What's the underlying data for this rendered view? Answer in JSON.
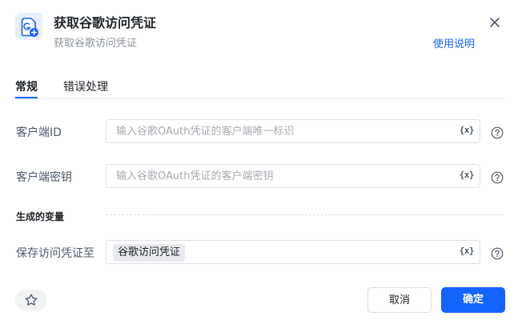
{
  "header": {
    "title": "获取谷歌访问凭证",
    "subtitle": "获取谷歌访问凭证",
    "help_link": "使用说明",
    "icon": "google-credential-icon"
  },
  "tabs": [
    {
      "label": "常规",
      "active": true
    },
    {
      "label": "错误处理",
      "active": false
    }
  ],
  "fields": {
    "client_id": {
      "label": "客户端ID",
      "placeholder": "输入谷歌OAuth凭证的客户端唯一标识",
      "value": "",
      "var_button": "{x}"
    },
    "client_secret": {
      "label": "客户端密钥",
      "placeholder": "输入谷歌OAuth凭证的客户端密钥",
      "value": "",
      "var_button": "{x}"
    }
  },
  "output_section": {
    "title": "生成的变量",
    "save_to": {
      "label": "保存访问凭证至",
      "variable": "谷歌访问凭证",
      "var_button": "{x}"
    }
  },
  "footer": {
    "cancel_label": "取消",
    "confirm_label": "确定"
  },
  "colors": {
    "accent": "#1664ff",
    "icon_bg": "#e9f0fd"
  }
}
